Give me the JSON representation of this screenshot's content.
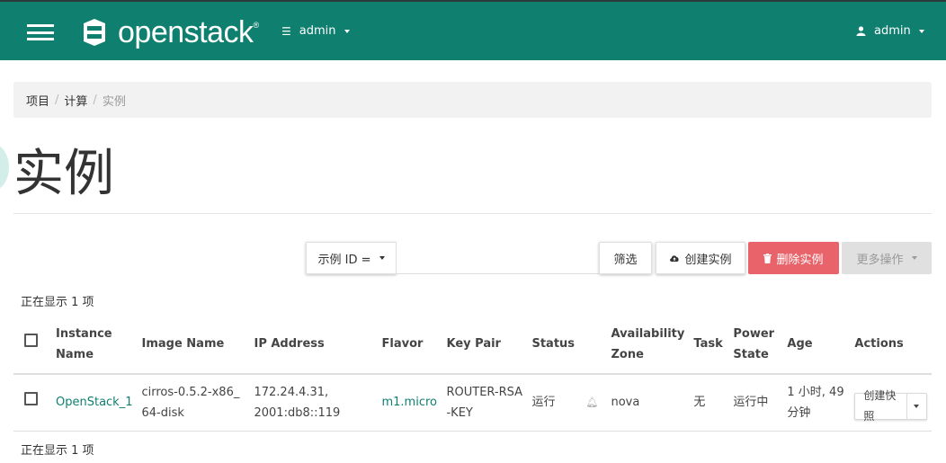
{
  "nav": {
    "project_label": "admin",
    "user_label": "admin"
  },
  "logo": {
    "text": "openstack"
  },
  "breadcrumb": {
    "items": [
      "项目",
      "计算",
      "实例"
    ]
  },
  "page": {
    "title": "实例"
  },
  "toolbar": {
    "filter_field": "示例 ID =",
    "filter_value": "",
    "filter_btn": "筛选",
    "create_btn": "创建实例",
    "delete_btn": "删除实例",
    "more_btn": "更多操作"
  },
  "count_text": "正在显示 1 项",
  "table": {
    "headers": [
      "Instance Name",
      "Image Name",
      "IP Address",
      "Flavor",
      "Key Pair",
      "Status",
      "Availability Zone",
      "Task",
      "Power State",
      "Age",
      "Actions"
    ],
    "rows": [
      {
        "name": "OpenStack_1",
        "image": "cirros-0.5.2-x86_64-disk",
        "ip": "172.24.4.31, 2001:db8::119",
        "flavor": "m1.micro",
        "keypair": "ROUTER-RSA-KEY",
        "status": "运行",
        "zone": "nova",
        "task": "无",
        "power": "运行中",
        "age": "1 小时, 49 分钟",
        "action": "创建快照"
      }
    ]
  },
  "colors": {
    "navbar": "#0f7f70",
    "danger": "#e8636a",
    "link": "#0f7f70"
  }
}
